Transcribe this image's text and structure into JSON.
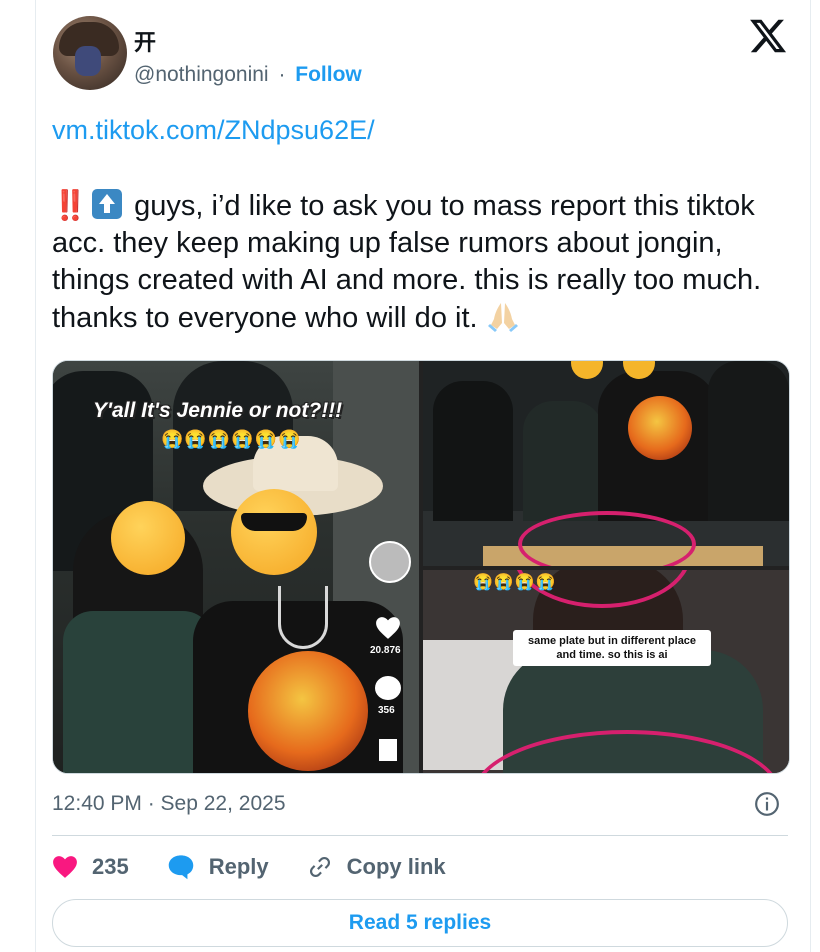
{
  "author": {
    "display_name": "开",
    "handle": "@nothingonini",
    "separator": "·",
    "follow_label": "Follow"
  },
  "tweet": {
    "link": "vm.tiktok.com/ZNdpsu62E/",
    "bangbang": "‼️",
    "text_main": "guys, i’d like to ask you to mass report this tiktok acc. they keep making up false rumors about jongin, things created with AI and more. this is really too much. thanks to everyone who will do it.",
    "icons": [
      "double-exclamation-icon",
      "up-arrow-icon",
      "folded-hands-icon"
    ]
  },
  "media": {
    "left_overlay_title": "Y'all It's Jennie or not?!!!",
    "left_overlay_emojis": "😭😭😭😭😭😭",
    "left_like_count": "20.876",
    "left_comment_count": "356",
    "right_overlay_emojis": "😭😭😭😭",
    "right_caption": "same plate but in different place and time. so this is ai"
  },
  "meta": {
    "timestamp": "12:40 PM · Sep 22, 2025"
  },
  "actions": {
    "like_count": "235",
    "reply_label": "Reply",
    "copy_link_label": "Copy link"
  },
  "read_replies_label": "Read 5 replies",
  "colors": {
    "accent": "#1d9bf0",
    "like": "#f91880",
    "text": "#0f1419",
    "muted": "#536471"
  }
}
